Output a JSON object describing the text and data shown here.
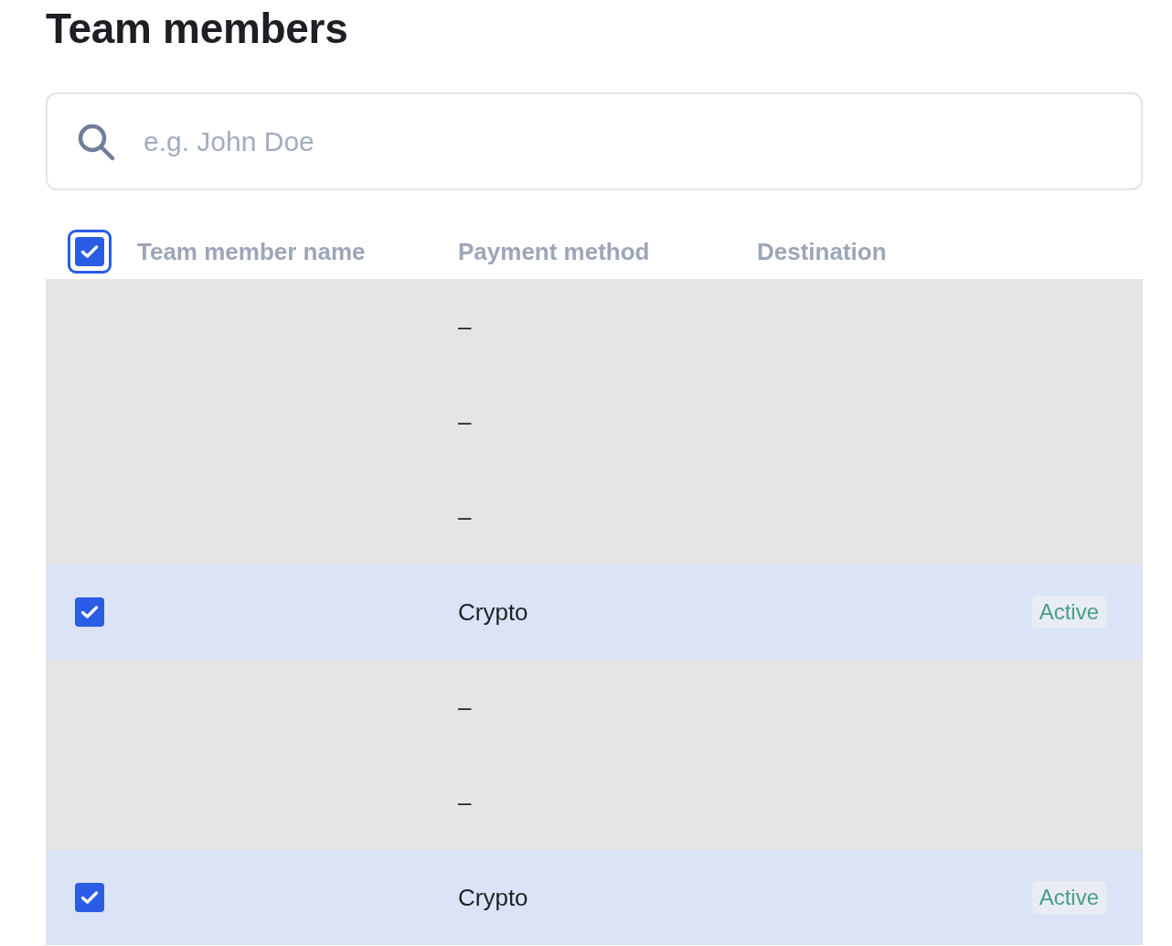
{
  "title": "Team members",
  "search": {
    "placeholder": "e.g. John Doe"
  },
  "table": {
    "select_all": {
      "checked": true,
      "focused": true
    },
    "columns": [
      "Team member name",
      "Payment method",
      "Destination"
    ],
    "rows": [
      {
        "selected": false,
        "payment_method": "–"
      },
      {
        "selected": false,
        "payment_method": "–"
      },
      {
        "selected": false,
        "payment_method": "–"
      },
      {
        "selected": true,
        "payment_method": "Crypto",
        "status": "Active"
      },
      {
        "selected": false,
        "payment_method": "–"
      },
      {
        "selected": false,
        "payment_method": "–"
      },
      {
        "selected": true,
        "payment_method": "Crypto",
        "status": "Active"
      }
    ]
  }
}
